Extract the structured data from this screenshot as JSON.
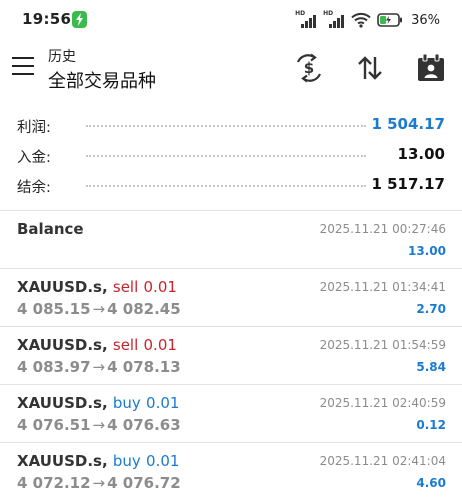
{
  "status_bar": {
    "time": "19:56",
    "network_label": "HD",
    "battery_percent": "36%",
    "battery_level": 0.36
  },
  "header": {
    "subtitle": "历史",
    "title": "全部交易品种",
    "icons": [
      "menu-icon",
      "dollar-swap-icon",
      "sort-arrows-icon",
      "calendar-icon"
    ]
  },
  "summary": {
    "profit": {
      "label": "利润:",
      "value": "1 504.17"
    },
    "deposit": {
      "label": "入金:",
      "value": "13.00"
    },
    "balance": {
      "label": "结余:",
      "value": "1 517.17"
    }
  },
  "deals": [
    {
      "symbol": "Balance",
      "side": "",
      "volume": "",
      "price_open": "",
      "price_close": "",
      "time": "2025.11.21 00:27:46",
      "amount": "13.00"
    },
    {
      "symbol": "XAUUSD.s,",
      "side": "sell",
      "volume": "0.01",
      "price_open": "4 085.15",
      "price_close": "4 082.45",
      "time": "2025.11.21 01:34:41",
      "amount": "2.70"
    },
    {
      "symbol": "XAUUSD.s,",
      "side": "sell",
      "volume": "0.01",
      "price_open": "4 083.97",
      "price_close": "4 078.13",
      "time": "2025.11.21 01:54:59",
      "amount": "5.84"
    },
    {
      "symbol": "XAUUSD.s,",
      "side": "buy",
      "volume": "0.01",
      "price_open": "4 076.51",
      "price_close": "4 076.63",
      "time": "2025.11.21 02:40:59",
      "amount": "0.12"
    },
    {
      "symbol": "XAUUSD.s,",
      "side": "buy",
      "volume": "0.01",
      "price_open": "4 072.12",
      "price_close": "4 076.72",
      "time": "2025.11.21 02:41:04",
      "amount": "4.60"
    }
  ],
  "colors": {
    "accent_blue": "#1a7bd0",
    "sell_red": "#c8242c",
    "muted_gray": "#8c8c8c",
    "notif_green": "#3dba4e"
  }
}
